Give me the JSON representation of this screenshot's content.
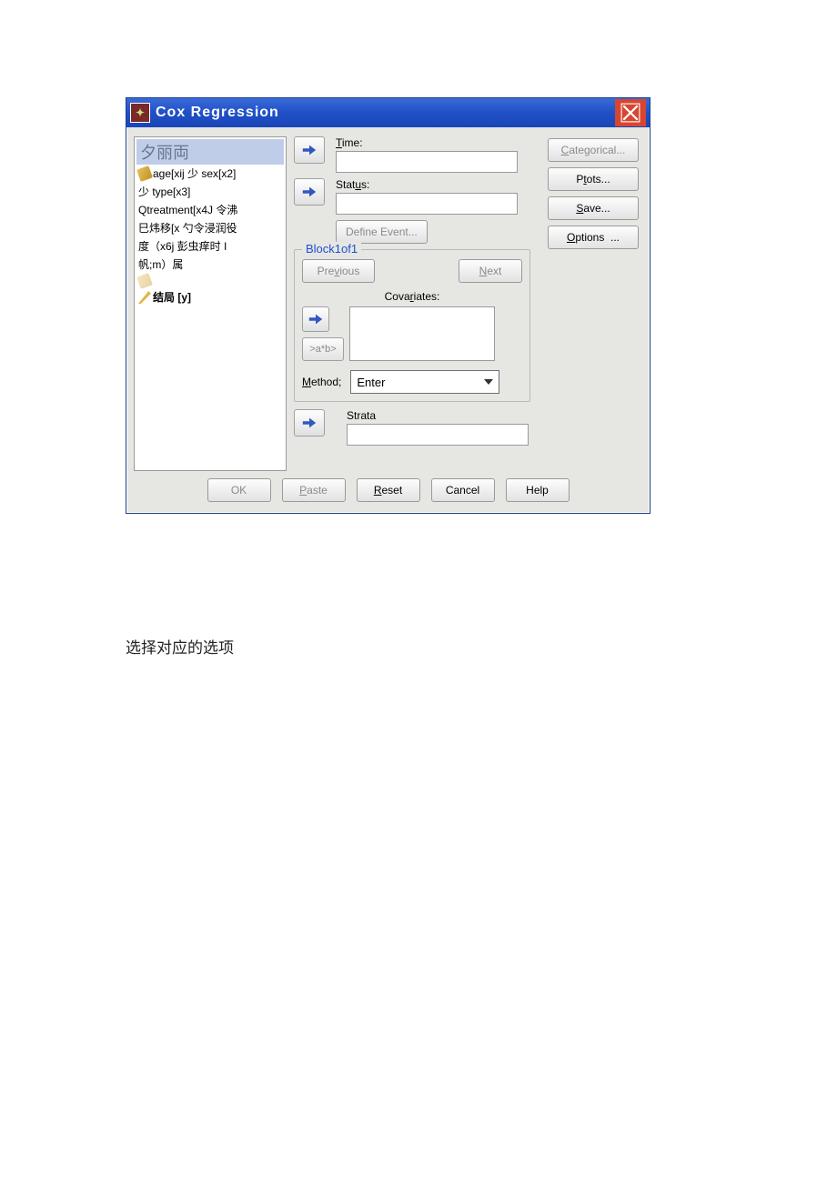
{
  "title": "Cox Regression",
  "varlist": {
    "selected": "夕丽両",
    "rows": [
      "age[xij 少 sex[x2]",
      "少 type[x3]",
      "Qtreatment[x4J 令沸",
      "巳炜移[x 勺令浸润役",
      "度（x6j 彭虫痒时 I",
      "帆;m）属",
      "",
      "结局 [y]"
    ]
  },
  "labels": {
    "time": "Time:",
    "status": "Status:",
    "define_event": "Define Event...",
    "block": "Block1of1",
    "previous": "Previous",
    "next": "Next",
    "covariates": "Covariates:",
    "ab": ">a*b>",
    "method": "Method;",
    "strata": "Strata"
  },
  "method_value": "Enter",
  "side": {
    "categorical": "Categorical...",
    "plots": "Ptots...",
    "save": "Save...",
    "options": "Options  ..."
  },
  "bottom": {
    "ok": "OK",
    "paste": "Paste",
    "reset": "Reset",
    "cancel": "Cancel",
    "help": "Help"
  },
  "caption": "选择对应的选项"
}
